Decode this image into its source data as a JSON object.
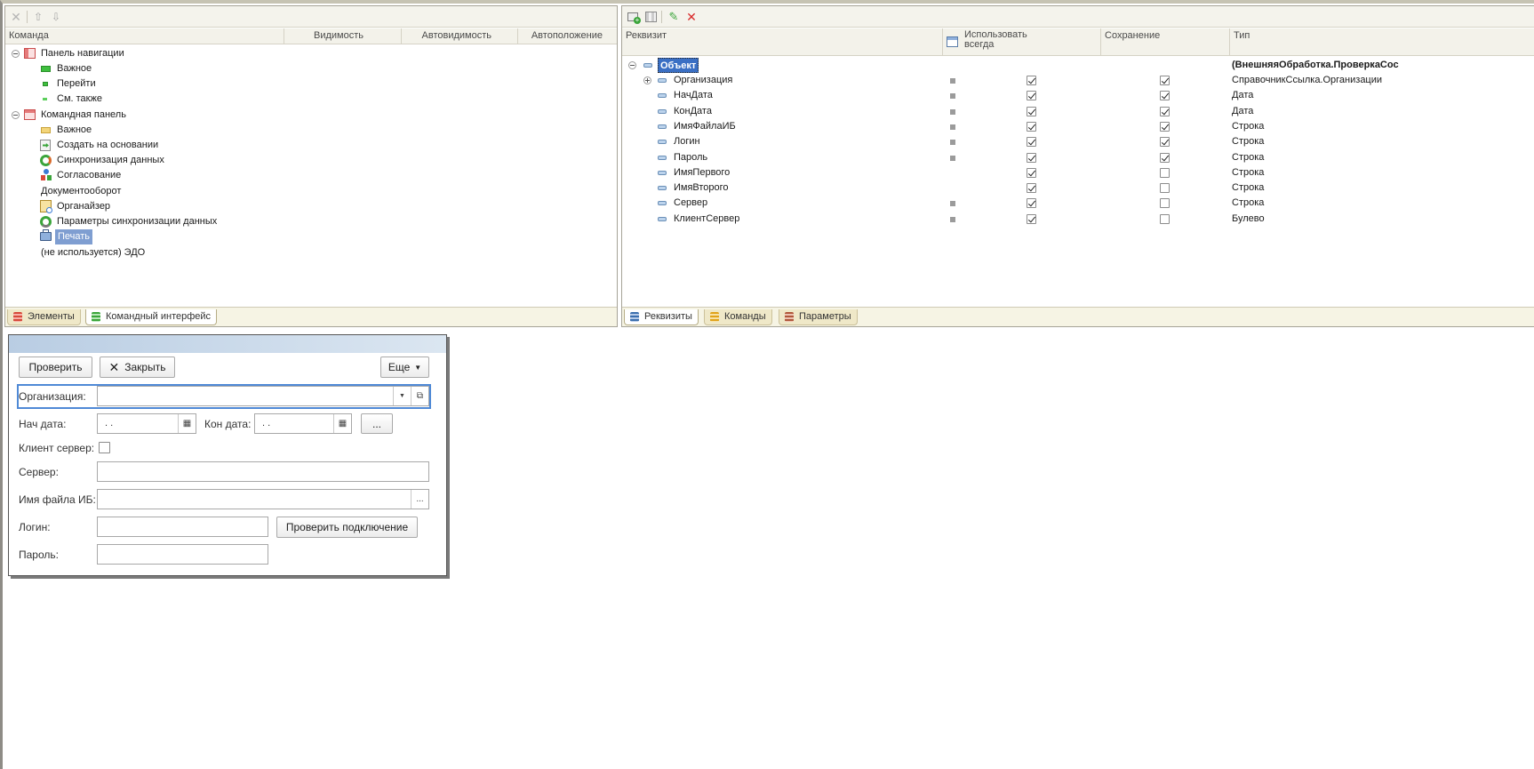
{
  "left_panel": {
    "columns": [
      "Команда",
      "Видимость",
      "Автовидимость",
      "Автоположение"
    ],
    "tree": [
      {
        "label": "Панель навигации",
        "level": 0,
        "icon": "navigation-panel-icon"
      },
      {
        "label": "Важное",
        "level": 1,
        "icon": "green-bar-icon"
      },
      {
        "label": "Перейти",
        "level": 1,
        "icon": "green-small-icon"
      },
      {
        "label": "См. также",
        "level": 1,
        "icon": "green-tiny-icon"
      },
      {
        "label": "Командная панель",
        "level": 0,
        "icon": "command-panel-icon"
      },
      {
        "label": "Важное",
        "level": 1,
        "icon": "yellow-bar-icon"
      },
      {
        "label": "Создать на основании",
        "level": 1,
        "icon": "create-based-on-icon"
      },
      {
        "label": "Синхронизация данных",
        "level": 1,
        "icon": "sync-icon"
      },
      {
        "label": "Согласование",
        "level": 1,
        "icon": "approval-icon"
      },
      {
        "label": "Документооборот",
        "level": 1,
        "icon": ""
      },
      {
        "label": "Органайзер",
        "level": 1,
        "icon": "organizer-icon"
      },
      {
        "label": "Параметры синхронизации данных",
        "level": 1,
        "icon": "sync-settings-icon"
      },
      {
        "label": "Печать",
        "level": 1,
        "icon": "printer-icon"
      },
      {
        "label": "(не используется) ЭДО",
        "level": 1,
        "icon": ""
      }
    ],
    "tabs": [
      "Элементы",
      "Командный интерфейс"
    ]
  },
  "right_panel": {
    "columns": [
      "Реквизит",
      "Использовать всегда",
      "Сохранение",
      "Тип"
    ],
    "root": {
      "name": "Объект",
      "type": "(ВнешняяОбработка.ПроверкаСос"
    },
    "rows": [
      {
        "name": "Организация",
        "dot": true,
        "use": true,
        "save": true,
        "type": "СправочникСсылка.Организации",
        "expandable": true
      },
      {
        "name": "НачДата",
        "dot": true,
        "use": true,
        "save": true,
        "type": "Дата"
      },
      {
        "name": "КонДата",
        "dot": true,
        "use": true,
        "save": true,
        "type": "Дата"
      },
      {
        "name": "ИмяФайлаИБ",
        "dot": true,
        "use": true,
        "save": true,
        "type": "Строка"
      },
      {
        "name": "Логин",
        "dot": true,
        "use": true,
        "save": true,
        "type": "Строка"
      },
      {
        "name": "Пароль",
        "dot": true,
        "use": true,
        "save": true,
        "type": "Строка"
      },
      {
        "name": "ИмяПервого",
        "dot": false,
        "use": true,
        "save": false,
        "type": "Строка"
      },
      {
        "name": "ИмяВторого",
        "dot": false,
        "use": true,
        "save": false,
        "type": "Строка"
      },
      {
        "name": "Сервер",
        "dot": true,
        "use": true,
        "save": false,
        "type": "Строка"
      },
      {
        "name": "КлиентСервер",
        "dot": true,
        "use": true,
        "save": false,
        "type": "Булево"
      }
    ],
    "tabs": [
      "Реквизиты",
      "Команды",
      "Параметры"
    ]
  },
  "form": {
    "check_button": "Проверить",
    "close_button": "Закрыть",
    "more_button": "Еще",
    "org_label": "Организация:",
    "start_label": "Нач дата:",
    "start_value": ".  .",
    "end_label": "Кон дата:",
    "end_value": ".  .",
    "period_button": "...",
    "client_server_label": "Клиент сервер:",
    "server_label": "Сервер:",
    "ib_file_label": "Имя файла ИБ:",
    "ib_file_button": "...",
    "login_label": "Логин:",
    "test_connection_button": "Проверить подключение",
    "password_label": "Пароль:"
  },
  "colors": {
    "accent": "#3a6fc4",
    "selection": "#7f9ed1",
    "delete": "#d92b2b"
  }
}
